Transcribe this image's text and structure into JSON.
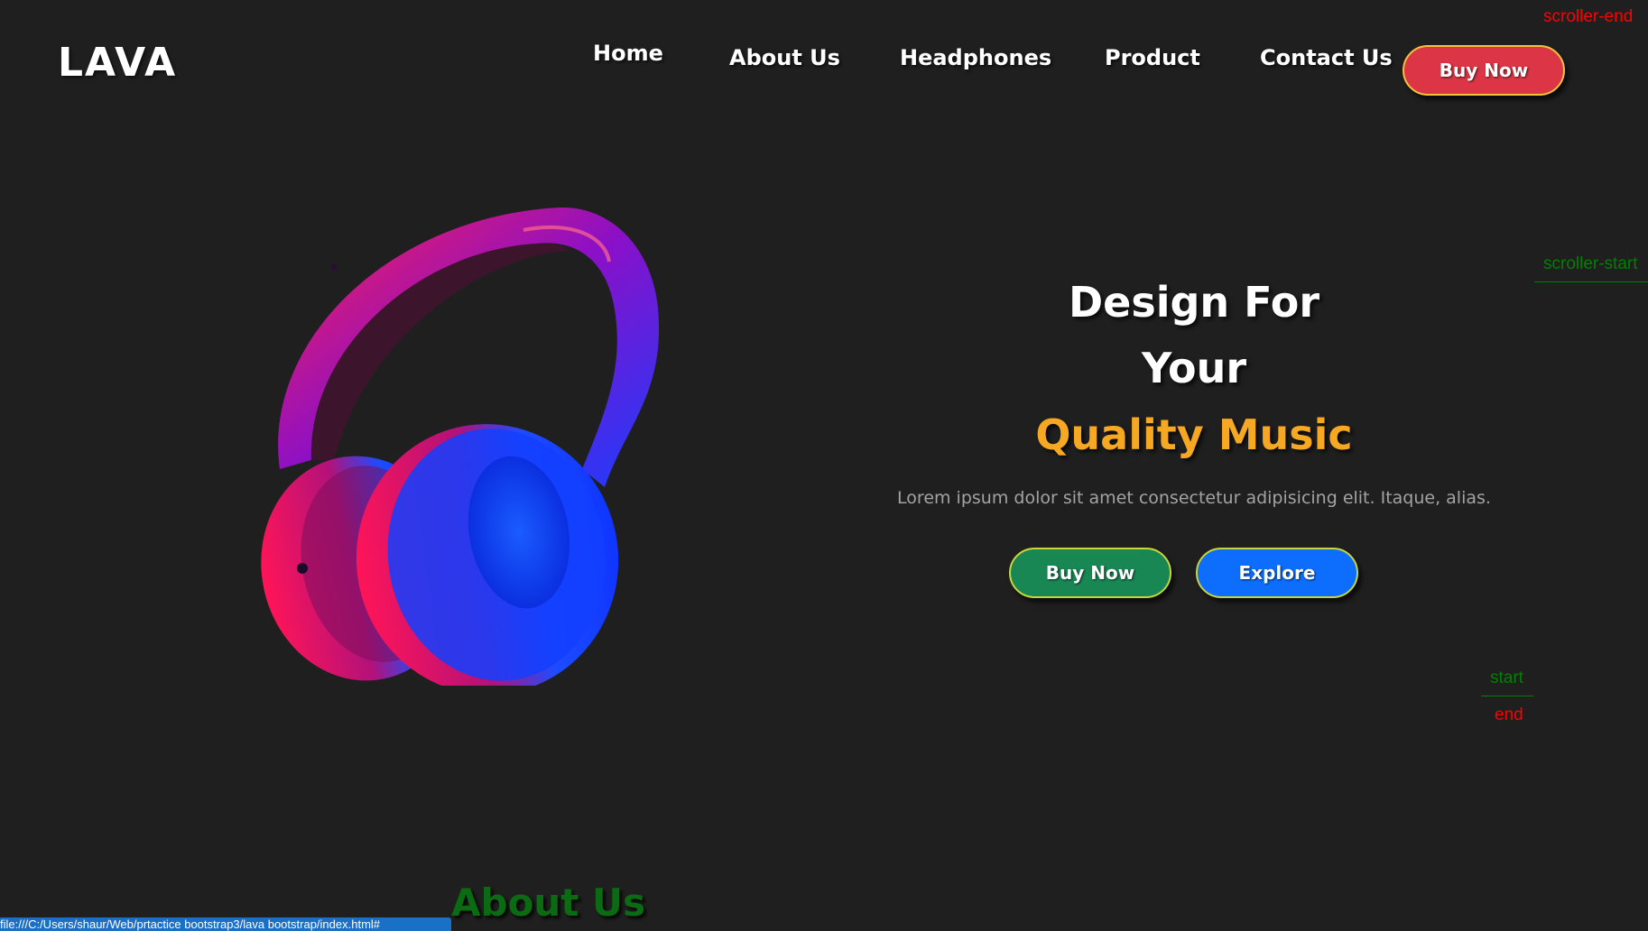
{
  "brand": {
    "logo": "LAVA"
  },
  "nav": {
    "items": [
      {
        "label": "Home"
      },
      {
        "label": "About Us"
      },
      {
        "label": "Headphones"
      },
      {
        "label": "Product"
      },
      {
        "label": "Contact Us"
      }
    ],
    "buy_button": "Buy Now"
  },
  "hero": {
    "line1": "Design For",
    "line2": "Your",
    "line3": "Quality Music",
    "description": "Lorem ipsum dolor sit amet consectetur adipisicing elit. Itaque, alias.",
    "buy_button": "Buy Now",
    "explore_button": "Explore"
  },
  "scroll_markers": {
    "scroller_end": "scroller-end",
    "scroller_start": "scroller-start",
    "start": "start",
    "end": "end"
  },
  "about": {
    "heading": "About Us"
  },
  "status_bar": {
    "url": "file:///C:/Users/shaur/Web/prtactice bootstrap3/lava bootstrap/index.html#"
  },
  "colors": {
    "background": "#1f1f1f",
    "accent_orange": "#f6a822",
    "buy_red": "#dc3545",
    "buy_green": "#198754",
    "explore_blue": "#0d6efd",
    "marker_red": "#ff0000",
    "marker_green": "#008000"
  },
  "icons": {
    "hero_image": "headphones-icon"
  }
}
